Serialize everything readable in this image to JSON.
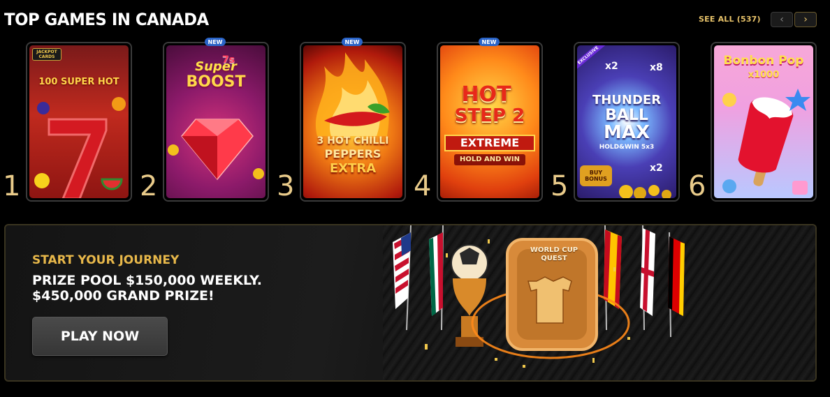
{
  "section": {
    "title": "TOP GAMES IN CANADA",
    "see_all_label": "SEE ALL",
    "see_all_count": "(537)",
    "prev_icon": "chevron-left-icon",
    "next_icon": "chevron-right-icon"
  },
  "games": [
    {
      "rank": "1",
      "new": false,
      "title_lines": [
        "100 SUPER HOT"
      ],
      "logo": "JACKPOT CARDS"
    },
    {
      "rank": "2",
      "new": true,
      "new_label": "NEW",
      "title_lines": [
        "Super",
        "7s",
        "BOOST"
      ]
    },
    {
      "rank": "3",
      "new": true,
      "new_label": "NEW",
      "title_lines": [
        "3 HOT CHILLI",
        "PEPPERS",
        "EXTRA"
      ]
    },
    {
      "rank": "4",
      "new": true,
      "new_label": "NEW",
      "title_lines": [
        "HOT",
        "STEP 2",
        "EXTREME",
        "HOLD AND WIN"
      ]
    },
    {
      "rank": "5",
      "new": false,
      "title_lines": [
        "THUNDER",
        "BALL",
        "MAX",
        "HOLD&WIN 5x3"
      ],
      "tag": "EXCLUSIVE",
      "multipliers": [
        "x2",
        "x8",
        "x2"
      ],
      "buy_bonus": "BUY BONUS"
    },
    {
      "rank": "6",
      "new": false,
      "title_lines": [
        "Bonbon Pop",
        "x1000"
      ]
    }
  ],
  "banner": {
    "subtitle": "START YOUR JOURNEY",
    "headline_line1": "PRIZE POOL $150,000 WEEKLY.",
    "headline_line2": "$450,000 GRAND PRIZE!",
    "cta_label": "PLAY NOW",
    "badge_title": "WORLD CUP QUEST"
  },
  "colors": {
    "accent_gold": "#e8b84a",
    "rank_gold": "#e9cb8a",
    "new_badge": "#2a64c8"
  }
}
